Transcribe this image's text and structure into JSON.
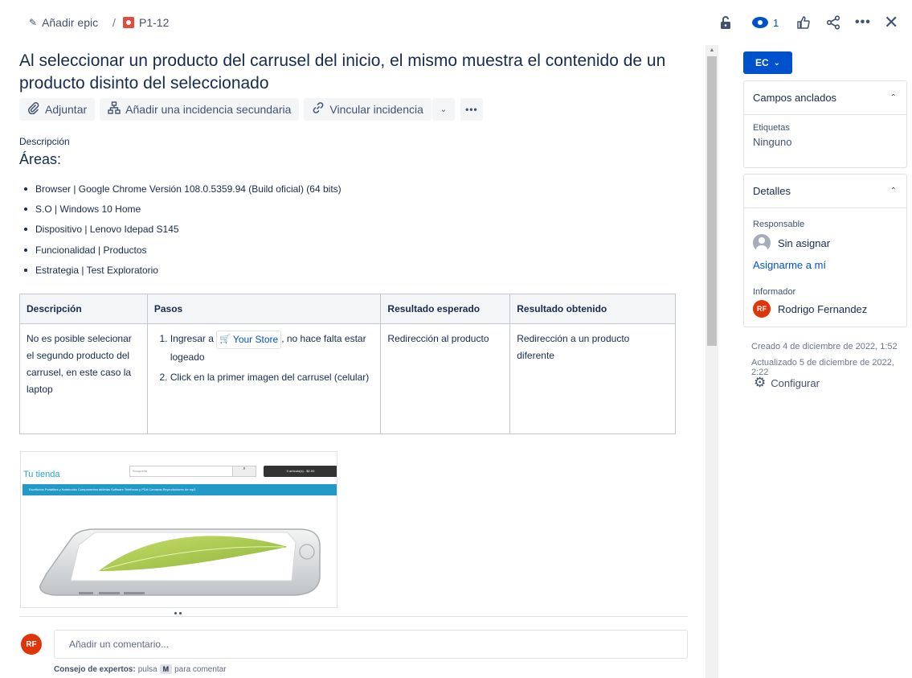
{
  "breadcrumb": {
    "epic_label": "Añadir epic",
    "separator": "/",
    "issue_key": "P1-12"
  },
  "toolbar": {
    "watchers_count": "1",
    "icons": [
      "lock-icon",
      "eye-icon",
      "like-icon",
      "share-icon",
      "more-icon",
      "close-icon"
    ]
  },
  "issue": {
    "title": "Al seleccionar un producto del carrusel del inicio, el mismo muestra el contenido de un producto disinto del seleccionado",
    "actions": {
      "attach": "Adjuntar",
      "add_child": "Añadir una incidencia secundaria",
      "link": "Vincular incidencia"
    },
    "description_label": "Descripción",
    "areas_heading": "Áreas:",
    "areas": [
      "Browser | Google Chrome Versión 108.0.5359.94 (Build oficial) (64 bits)",
      "S.O | Windows 10 Home",
      "Dispositivo | Lenovo Idepad S145",
      "Funcionalidad | Productos",
      "Estrategia | Test Exploratorio"
    ],
    "table": {
      "headers": [
        "Descripción",
        "Pasos",
        "Resultado esperado",
        "Resultado obtenido"
      ],
      "description": "No es posible selecionar el segundo producto del carrusel, en este caso la laptop",
      "step1_prefix": "Ingresar a",
      "step1_link": "Your Store",
      "step1_suffix": ", no hace falta estar logeado",
      "step2": "Click en la primer  imagen del carrusel (celular)",
      "expected": "Redirección al producto",
      "obtained": "Redirección a un producto diferente"
    },
    "attachment": {
      "brand": "Tu tienda",
      "search_placeholder": "Búsqueda",
      "cart": "0 artículo(s) - $0.00",
      "nav": "Escritorios    Portátiles y Notebooks    Componentes    tabletas    Software    Teléfonos y PDA    Cámaras    Reproductores de mp3"
    }
  },
  "comment": {
    "avatar_initials": "RF",
    "placeholder": "Añadir un comentario...",
    "tip_bold": "Consejo de expertos:",
    "tip_text": "pulsa",
    "tip_key": "M",
    "tip_after": "para comentar"
  },
  "sidebar": {
    "status": "EC",
    "pinned": {
      "heading": "Campos anclados",
      "labels_label": "Etiquetas",
      "labels_value": "Ninguno"
    },
    "details": {
      "heading": "Detalles",
      "assignee_label": "Responsable",
      "assignee_value": "Sin asignar",
      "assign_me": "Asignarme a mí",
      "reporter_label": "Informador",
      "reporter_initials": "RF",
      "reporter_name": "Rodrigo Fernandez"
    },
    "created": "Creado 4 de diciembre de 2022, 1:52",
    "updated": "Actualizado 5 de diciembre de 2022, 2:22",
    "configure": "Configurar"
  }
}
